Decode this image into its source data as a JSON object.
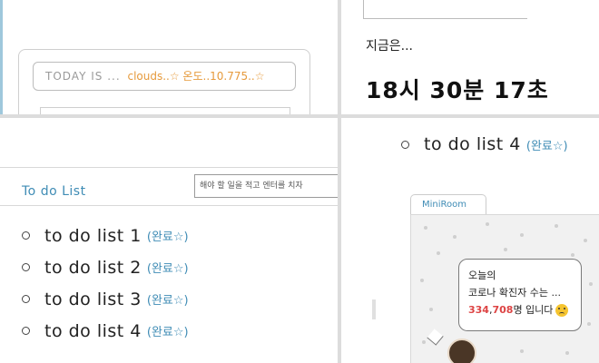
{
  "top_left": {
    "today_label": "TODAY IS ...",
    "today_value": "clouds..☆ 온도..10.775..☆"
  },
  "top_right": {
    "now_label": "지금은...",
    "time": "18시 30분 17초"
  },
  "todo": {
    "title": "To do List",
    "input_placeholder": "해야 할 일을 적고 엔터를 치자",
    "items": [
      {
        "text": "to do list 1",
        "status": "(완료☆)"
      },
      {
        "text": "to do list 2",
        "status": "(완료☆)"
      },
      {
        "text": "to do list 3",
        "status": "(완료☆)"
      },
      {
        "text": "to do list 4",
        "status": "(완료☆)"
      }
    ]
  },
  "bottom_right": {
    "item": {
      "text": "to do list 4",
      "status": "(완료☆)"
    },
    "miniroom_tab": "MiniRoom",
    "bubble": {
      "line1": "오늘의",
      "line2": "코로나 확진자 수는 ...",
      "count_part1": "334",
      "count_sep": ",",
      "count_part2": "708",
      "line3_suffix": "명 입니다"
    }
  },
  "colors": {
    "accent_blue": "#3f8cb5",
    "accent_orange": "#e69a3c",
    "count_red": "#d44444"
  }
}
